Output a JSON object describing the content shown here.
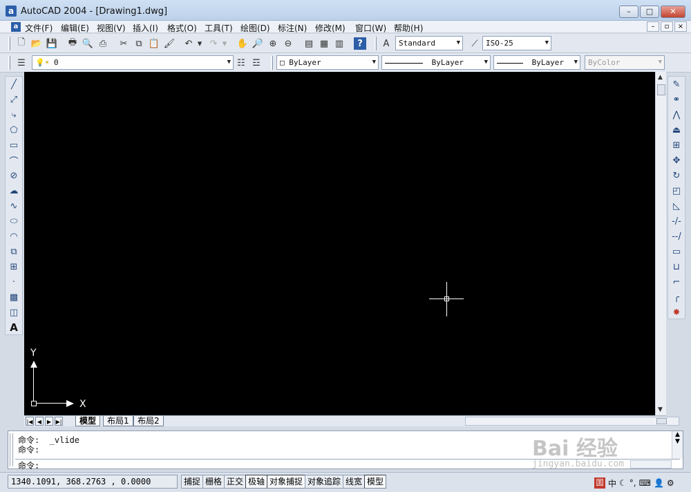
{
  "window": {
    "title": "AutoCAD 2004 - [Drawing1.dwg]",
    "app_icon": "a",
    "minimize": "–",
    "maximize": "□",
    "close": "✕"
  },
  "menubar": {
    "items": [
      "文件(F)",
      "编辑(E)",
      "视图(V)",
      "插入(I)",
      "格式(O)",
      "工具(T)",
      "绘图(D)",
      "标注(N)",
      "修改(M)",
      "窗口(W)",
      "帮助(H)"
    ],
    "mdi": [
      "–",
      "▫",
      "×"
    ]
  },
  "toolbar_standard": {
    "text_style": "Standard",
    "dim_style": "ISO-25"
  },
  "toolbar_properties": {
    "layer": "0",
    "color": "ByLayer",
    "linetype": "ByLayer",
    "lineweight": "ByLayer",
    "plot_style": "ByColor"
  },
  "draw_toolbar": [
    "line-icon",
    "construction-line-icon",
    "polyline-icon",
    "polygon-icon",
    "rectangle-icon",
    "arc-icon",
    "circle-icon",
    "revision-cloud-icon",
    "spline-icon",
    "ellipse-icon",
    "ellipse-arc-icon",
    "insert-block-icon",
    "make-block-icon",
    "point-icon",
    "hatch-icon",
    "region-icon",
    "multiline-text-icon"
  ],
  "modify_toolbar": [
    "erase-icon",
    "copy-icon",
    "mirror-icon",
    "offset-icon",
    "array-icon",
    "move-icon",
    "rotate-icon",
    "scale-icon",
    "stretch-icon",
    "trim-icon",
    "extend-icon",
    "break-icon",
    "join-icon",
    "chamfer-icon",
    "fillet-icon",
    "explode-icon"
  ],
  "ucs": {
    "x_label": "X",
    "y_label": "Y"
  },
  "tabs": {
    "items": [
      "模型",
      "布局1",
      "布局2"
    ],
    "active": "模型"
  },
  "command": {
    "line1": "命令:  _vlide",
    "line2": "命令:",
    "prompt": "命令:"
  },
  "status": {
    "coords": "1340.1091, 368.2763 , 0.0000",
    "toggles": [
      "捕捉",
      "栅格",
      "正交",
      "极轴",
      "对象捕捉",
      "对象追踪",
      "线宽",
      "模型"
    ]
  },
  "tray": {
    "ime": "囯",
    "lang": "中"
  },
  "watermark": {
    "text": "Bai 经验",
    "url": "jingyan.baidu.com"
  }
}
